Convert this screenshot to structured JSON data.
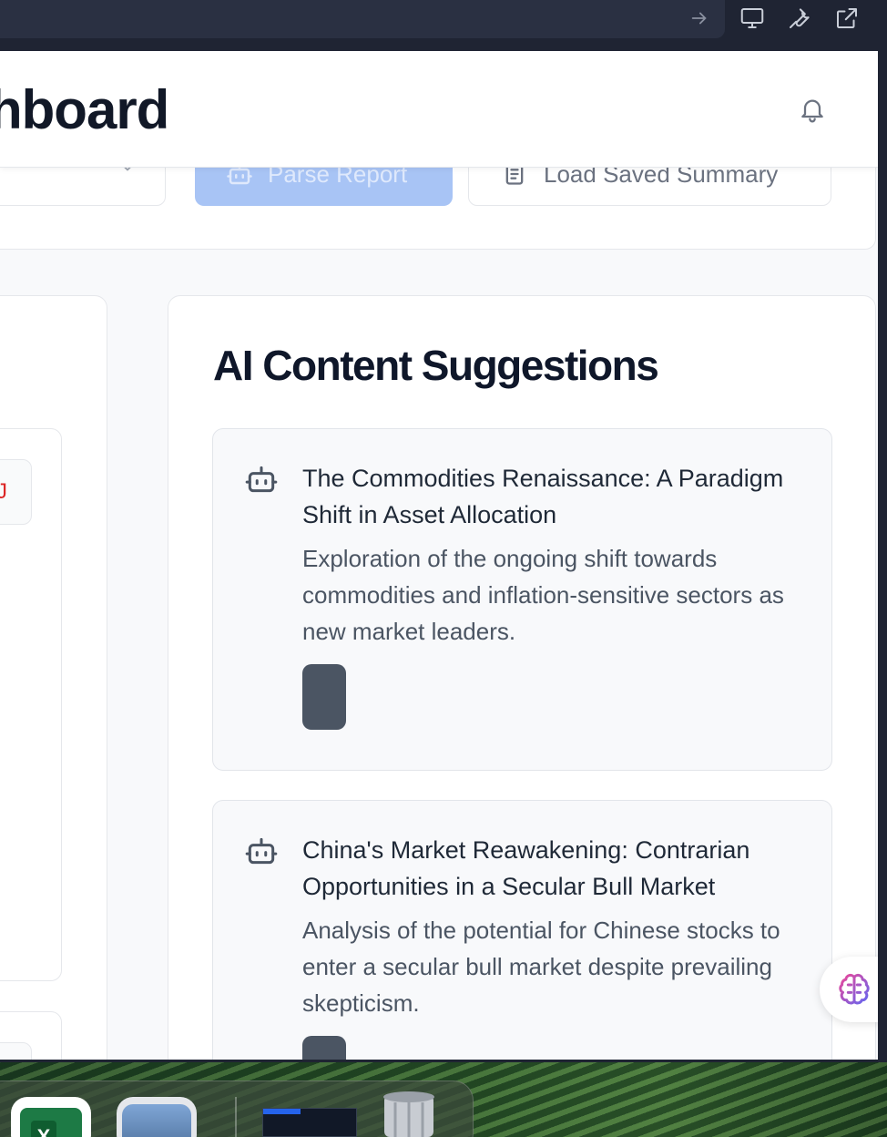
{
  "browser": {
    "toolbar_icons": [
      "arrow-right-icon",
      "monitor-icon",
      "wrench-icon",
      "external-link-icon"
    ]
  },
  "header": {
    "title_visible": "hboard"
  },
  "controls": {
    "parse_label": "Parse Report",
    "load_label": "Load Saved Summary"
  },
  "left_panel": {
    "chip_text": "J"
  },
  "suggestions": {
    "title": "AI Content Suggestions",
    "items": [
      {
        "title": "The Commodities Renaissance: A Paradigm Shift in Asset Allocation",
        "description": "Exploration of the ongoing shift towards commodities and inflation-sensitive sectors as new market leaders."
      },
      {
        "title": "China's Market Reawakening: Contrarian Opportunities in a Secular Bull Market",
        "description": "Analysis of the potential for Chinese stocks to enter a secular bull market despite prevailing skepticism."
      }
    ]
  },
  "colors": {
    "accent_disabled": "#a8c4f5",
    "tag": "#4b5563",
    "chrome": "#1f2433"
  },
  "dock": {
    "apps": [
      "excel-icon",
      "preview-icon",
      "screenshot-thumbnail",
      "trash-icon"
    ]
  }
}
